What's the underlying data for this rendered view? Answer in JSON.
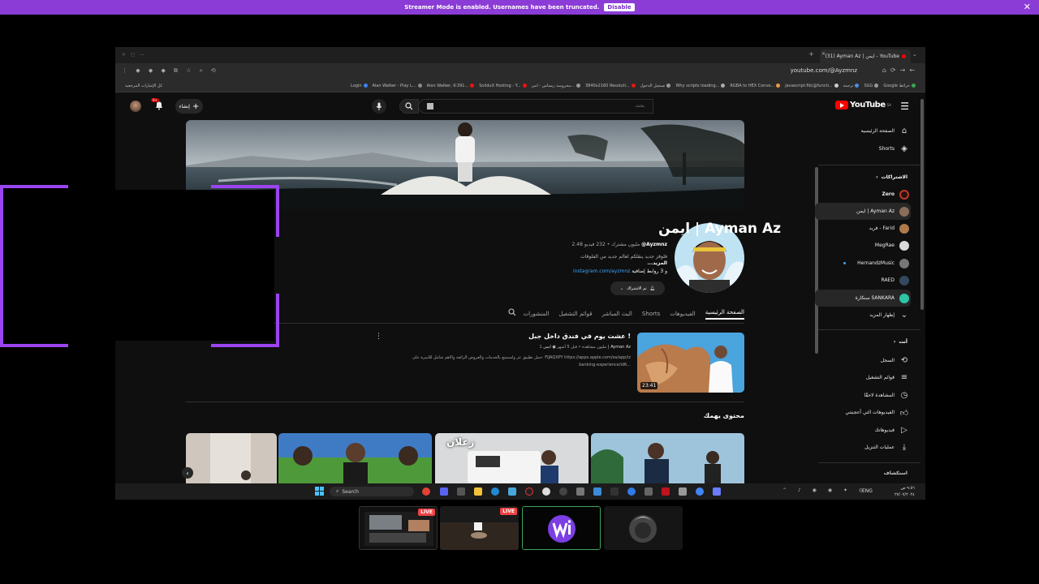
{
  "streamer_banner": {
    "message": "Streamer Mode is enabled. Usernames have been truncated.",
    "disable_label": "Disable",
    "close_label": "✕"
  },
  "browser": {
    "tab_title": "(31) Ayman Az | ايمن - YouTube",
    "url": "youtube.com/@Ayzmnz",
    "bookmarks": [
      "Login",
      "Alan Walker - Play L...",
      "Alan Walker, K-391...",
      "SoliduX Hosting - Y...",
      "محروسة زيساس - امي...",
      "3840x2160 Resoluti...",
      "تسجيل الدخول",
      "Why scripts loading...",
      "RGBA to HEX Conve...",
      "javascript:fib(@functi...",
      "ترجمة",
      "SGG",
      "Google خرائط",
      "كل الإشارات المرجعية"
    ]
  },
  "youtube": {
    "logo_text": "YouTube",
    "logo_sup": "SA",
    "search_placeholder": "بحث",
    "create_label": "إنشاء",
    "notif_count": "9+",
    "channel": {
      "name": "ايمن | Ayman Az",
      "handle": "@Ayzmnz",
      "stats": "2.48 مليون مشترك • 232 فيديو",
      "description": "فلوقز جديد ينقلكم لعالم جديد من الفلوقات",
      "more": "...المزيد",
      "link": "instagram.com/ayzmnz",
      "links_extra": "و 3 روابط إضافية",
      "subscribed_label": "تم الاشتراك"
    },
    "tabs": [
      "الصفحة الرئيسية",
      "الفيديوهات",
      "Shorts",
      "البث المباشر",
      "قوائم التشغيل",
      "المنشورات"
    ],
    "featured_video": {
      "title": "عشت يوم في فندق داخل جبل !",
      "channel": "ايمن | Ayman Az",
      "meta": "1 مليون مشاهدة • قبل 5 أشهر",
      "desc1": "حمل تطبيق عز واستمتع بالخدمات والعروض الرائعة والأهم شامل للأسرة على: FIJAQXPY https://apps.apple.com/sa/app/iz",
      "desc2": "banking-experience/id6...",
      "duration": "23:41"
    },
    "section_title": "محتوى يهمك",
    "shelf_overlay_text": "زعلان"
  },
  "sidebar": {
    "main": [
      {
        "label": "الصفحة الرئيسية",
        "icon": "home-icon"
      },
      {
        "label": "Shorts",
        "icon": "shorts-icon"
      }
    ],
    "subs_header": "الاشتراكات",
    "subscriptions": [
      {
        "label": "Zero",
        "color": "#c0392b"
      },
      {
        "label": "ايمن | Ayman Az",
        "color": "#8a6d5a"
      },
      {
        "label": "فريد - Farid",
        "color": "#b07a4c"
      },
      {
        "label": "MegRae",
        "color": "#d9d9d9"
      },
      {
        "label": "HernandzMusic",
        "color": "#777777"
      },
      {
        "label": "RAED",
        "color": "#34495e"
      },
      {
        "label": "سنكارة SANKARA",
        "color": "#2ec4a6"
      }
    ],
    "show_more": "إظهار المزيد",
    "you_header": "أنت",
    "you_items": [
      {
        "label": "السجل",
        "icon": "history-icon"
      },
      {
        "label": "قوائم التشغيل",
        "icon": "playlist-icon"
      },
      {
        "label": "المشاهدة لاحقًا",
        "icon": "clock-icon"
      },
      {
        "label": "الفيديوهات التي أعجبتني",
        "icon": "like-icon"
      },
      {
        "label": "فيديوهاتك",
        "icon": "video-icon"
      },
      {
        "label": "عمليات التنزيل",
        "icon": "download-icon"
      }
    ],
    "explore_header": "استكشاف"
  },
  "taskbar": {
    "search_label": "Search",
    "lang": "ENG",
    "time": "٩:٥٦ ص",
    "date": "٢٧/٠٧/٢٠٢٤"
  },
  "stream_thumbs": {
    "live_label": "LIVE"
  },
  "colors": {
    "banner": "#8b3cd6",
    "frame": "#9b45f0",
    "yt_red": "#ff0000"
  }
}
